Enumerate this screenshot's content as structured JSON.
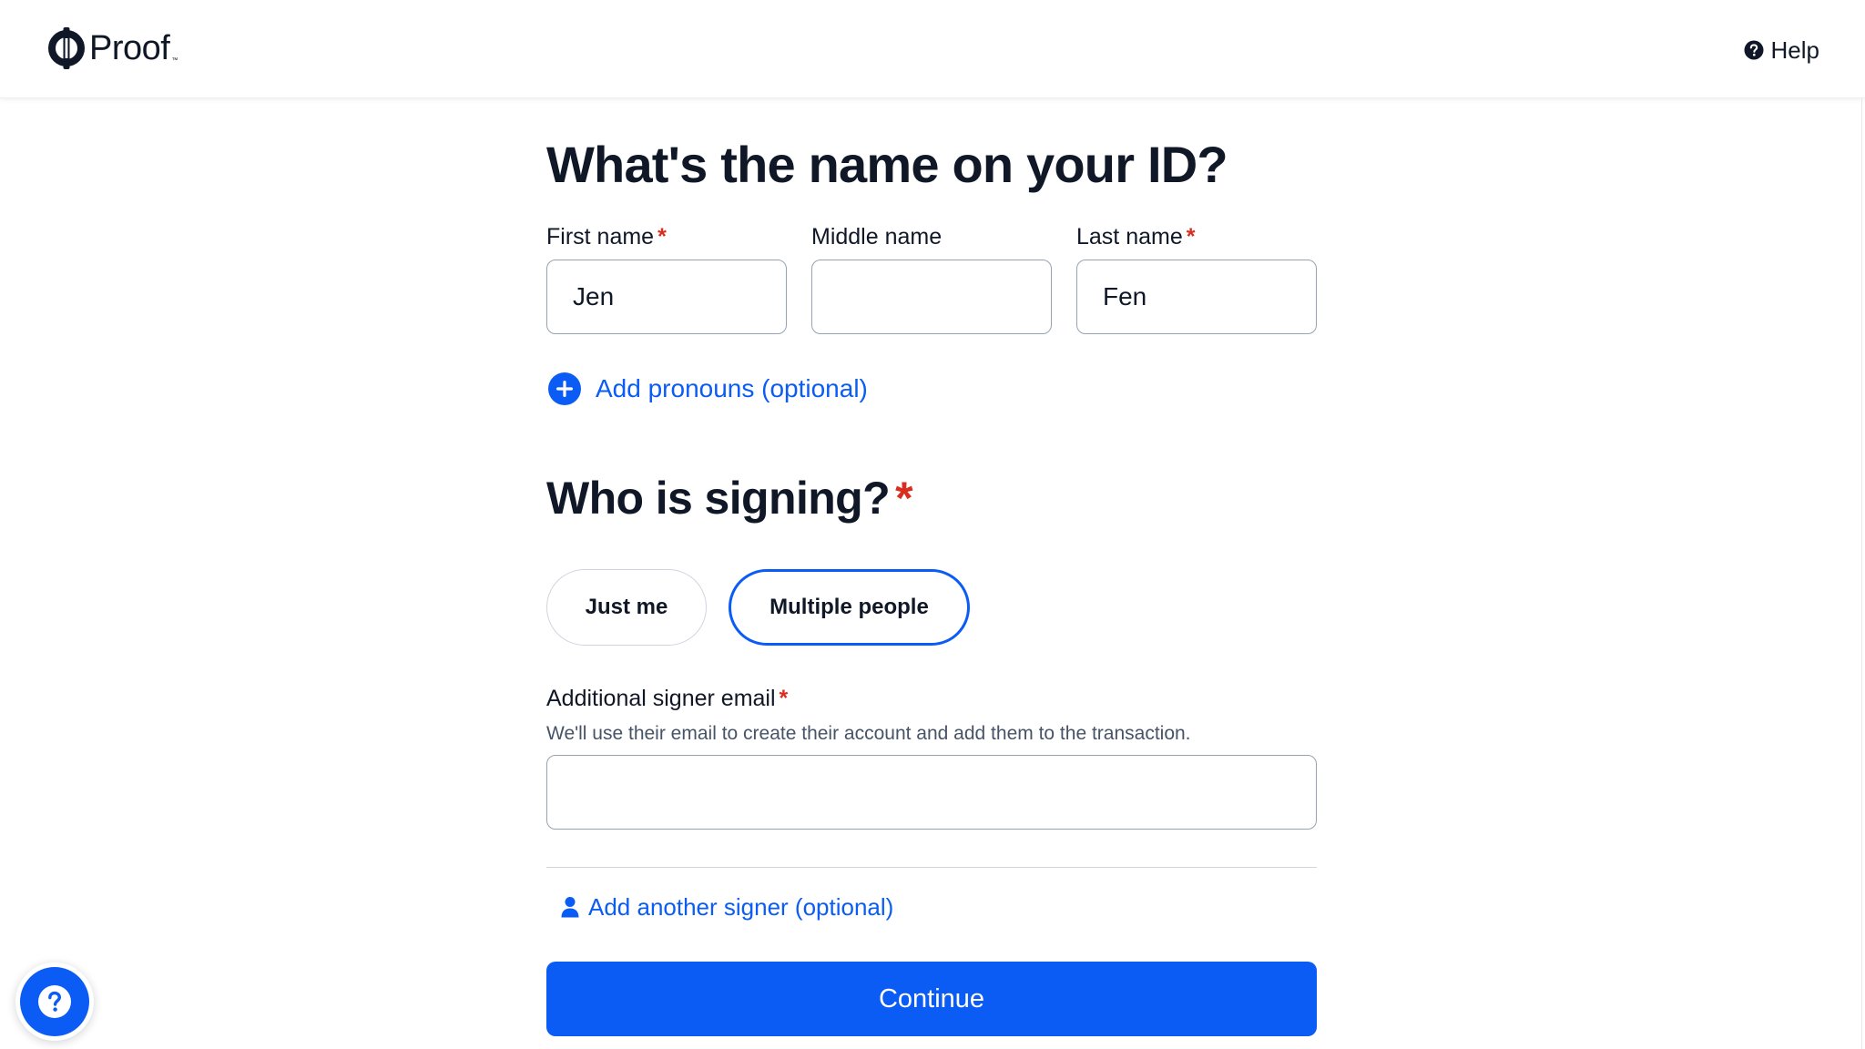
{
  "header": {
    "brand": "Proof",
    "brand_tm": "™",
    "help_label": "Help"
  },
  "form": {
    "title": "What's the name on your ID?",
    "required_mark": "*",
    "first_name": {
      "label": "First name",
      "value": "Jen"
    },
    "middle_name": {
      "label": "Middle name",
      "value": ""
    },
    "last_name": {
      "label": "Last name",
      "value": "Fen"
    },
    "pronouns_link": "Add pronouns (optional)",
    "signing_title": "Who is signing?",
    "signing_options": [
      {
        "label": "Just me",
        "selected": false
      },
      {
        "label": "Multiple people",
        "selected": true
      }
    ],
    "signer_email": {
      "label": "Additional signer email",
      "hint": "We'll use their email to create their account and add them to the transaction.",
      "value": ""
    },
    "add_signer_link": "Add another signer (optional)",
    "continue_label": "Continue"
  },
  "icons": {
    "help": "question-circle-icon",
    "plus": "plus-circle-icon",
    "person": "person-icon",
    "support": "question-icon"
  },
  "colors": {
    "accent": "#0b5cf5",
    "required": "#d92d20",
    "text": "#101828",
    "muted": "#475467"
  }
}
